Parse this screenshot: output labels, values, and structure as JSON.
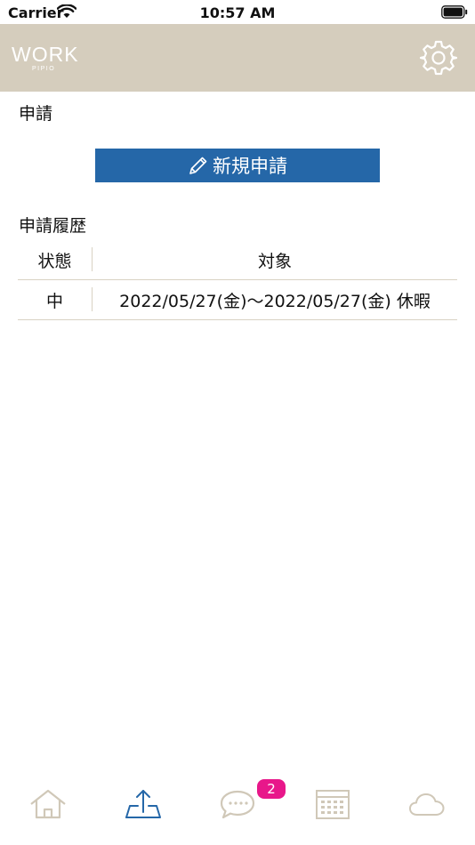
{
  "status": {
    "carrier": "Carrier",
    "time": "10:57 AM"
  },
  "header": {
    "logo_main": "WORK",
    "logo_sub": "PIPIO"
  },
  "section_new": {
    "title": "申請",
    "button_label": "新規申請"
  },
  "section_history": {
    "title": "申請履歴",
    "columns": {
      "state": "状態",
      "target": "対象"
    },
    "rows": [
      {
        "state": "中",
        "target": "2022/05/27(金)～2022/05/27(金) 休暇"
      }
    ]
  },
  "tabbar": {
    "badge": "2",
    "tabs": [
      "home-icon",
      "upload-icon",
      "chat-icon",
      "calendar-icon",
      "cloud-icon"
    ],
    "active_tab": 1
  },
  "colors": {
    "header_bg": "#d5cdbd",
    "accent": "#2567a8",
    "badge": "#e8178a",
    "tab_inactive": "#d0c8b8"
  }
}
